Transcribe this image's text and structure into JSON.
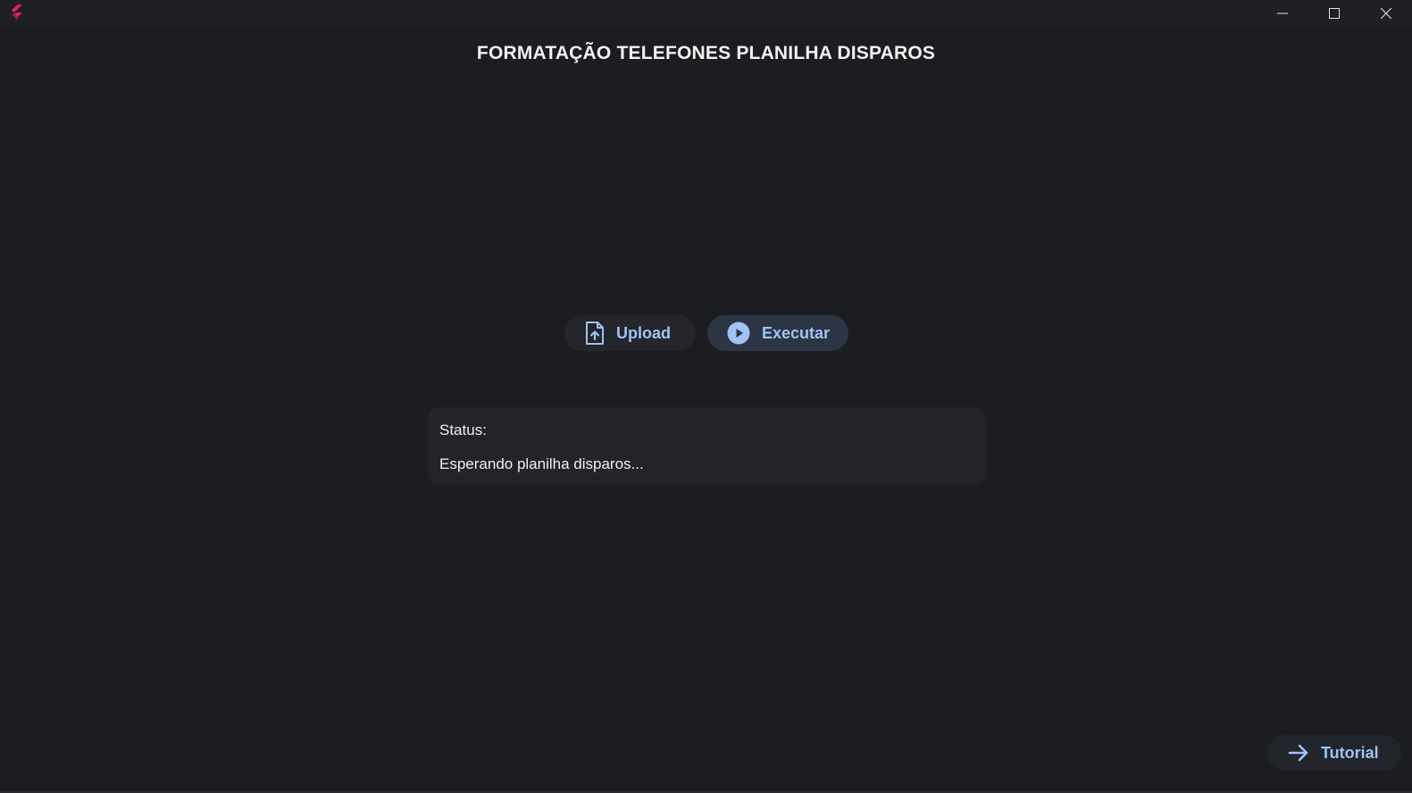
{
  "window": {
    "controls": {
      "minimize_icon": "minimize-icon",
      "maximize_icon": "maximize-icon",
      "close_icon": "close-icon"
    },
    "logo_icon": "flutter-logo-icon"
  },
  "header": {
    "title": "FORMATAÇÃO TELEFONES PLANILHA DISPAROS"
  },
  "actions": {
    "upload_label": "Upload",
    "upload_icon": "file-upload-icon",
    "execute_label": "Executar",
    "execute_icon": "play-circle-icon"
  },
  "status": {
    "label": "Status:",
    "message": "Esperando planilha disparos..."
  },
  "footer": {
    "tutorial_label": "Tutorial",
    "tutorial_icon": "arrow-right-icon"
  },
  "colors": {
    "background": "#1c1d20",
    "accent": "#9fc3f5",
    "panel": "#22242a"
  }
}
